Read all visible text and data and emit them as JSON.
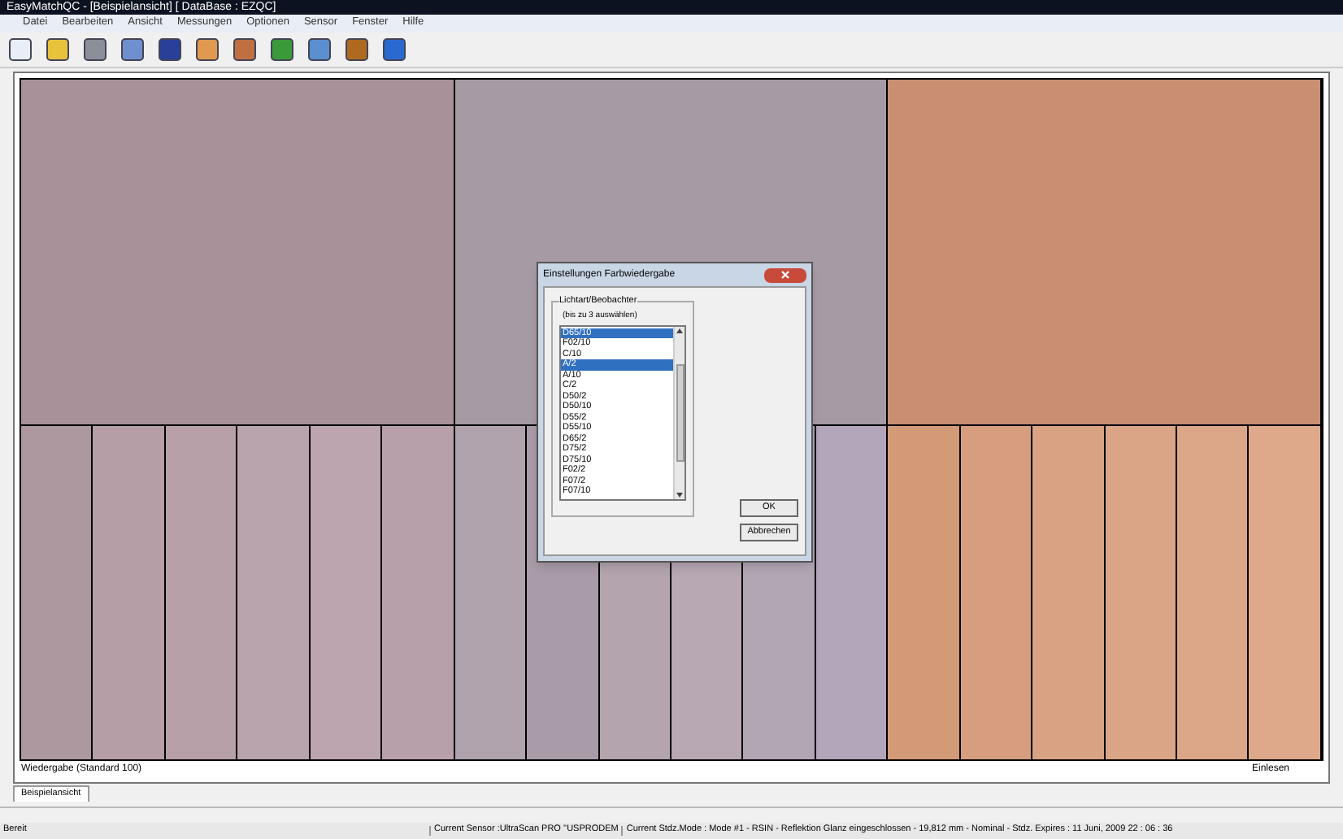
{
  "window": {
    "title": "EasyMatchQC - [Beispielansicht]   [ DataBase : EZQC]"
  },
  "menu": [
    "Datei",
    "Bearbeiten",
    "Ansicht",
    "Messungen",
    "Optionen",
    "Sensor",
    "Fenster",
    "Hilfe"
  ],
  "swatches": {
    "top": [
      {
        "color": "#a99199"
      },
      {
        "color": "#a69ba5"
      },
      {
        "color": "#c98f72"
      }
    ],
    "bottom": [
      {
        "color": "#ac989e"
      },
      {
        "color": "#b59ea5"
      },
      {
        "color": "#b7a0a8"
      },
      {
        "color": "#b9a3ad"
      },
      {
        "color": "#bca5ae"
      },
      {
        "color": "#b8a0aa"
      },
      {
        "color": "#b0a3ad"
      },
      {
        "color": "#a99ca8"
      },
      {
        "color": "#b3a4ae"
      },
      {
        "color": "#b7a8b3"
      },
      {
        "color": "#b2a5b4"
      },
      {
        "color": "#b3a6bb"
      },
      {
        "color": "#d39a78"
      },
      {
        "color": "#d69e7f"
      },
      {
        "color": "#d9a283"
      },
      {
        "color": "#daa486"
      },
      {
        "color": "#dca688"
      },
      {
        "color": "#dea98b"
      }
    ]
  },
  "dialog": {
    "title": "Einstellungen Farbwiedergabe",
    "group": "Lichtart/Beobachter",
    "hint": "(bis zu 3 auswählen)",
    "items": [
      {
        "label": "D65/10",
        "selected": true
      },
      {
        "label": "F02/10",
        "selected": false
      },
      {
        "label": "C/10",
        "selected": false
      },
      {
        "label": "A/2",
        "selected": true
      },
      {
        "label": "A/10",
        "selected": false
      },
      {
        "label": "C/2",
        "selected": false
      },
      {
        "label": "D50/2",
        "selected": false
      },
      {
        "label": "D50/10",
        "selected": false
      },
      {
        "label": "D55/2",
        "selected": false
      },
      {
        "label": "D55/10",
        "selected": false
      },
      {
        "label": "D65/2",
        "selected": false
      },
      {
        "label": "D75/2",
        "selected": false
      },
      {
        "label": "D75/10",
        "selected": false
      },
      {
        "label": "F02/2",
        "selected": false
      },
      {
        "label": "F07/2",
        "selected": false
      },
      {
        "label": "F07/10",
        "selected": false
      }
    ],
    "buttons": [
      "OK",
      "Abbrechen"
    ]
  },
  "footer": {
    "left": "Wiedergabe (Standard 100)",
    "right": "Einlesen"
  },
  "tabs": [
    {
      "label": "Beispielansicht",
      "selected": true
    }
  ],
  "status_bar": [
    "Bereit",
    "Current Sensor :UltraScan PRO ''USPRODEM",
    "Current Stdz.Mode :  Mode #1 - RSIN - Reflektion Glanz eingeschlossen - 19,812 mm - Nominal - Stdz. Expires : 11 Juni, 2009 22 : 06 : 36"
  ]
}
